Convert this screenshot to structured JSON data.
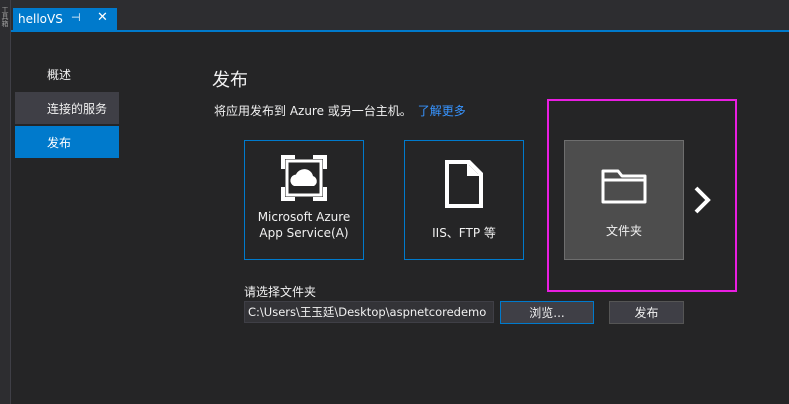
{
  "side_strip": {
    "label": "工具箱"
  },
  "tab": {
    "title": "helloVS",
    "pin_icon": "⊣",
    "close_icon": "✕"
  },
  "nav": {
    "items": [
      {
        "label": "概述",
        "state": "normal"
      },
      {
        "label": "连接的服务",
        "state": "hover"
      },
      {
        "label": "发布",
        "state": "active"
      }
    ]
  },
  "main": {
    "heading": "发布",
    "subtitle": "将应用发布到 Azure 或另一台主机。",
    "learn_more": "了解更多"
  },
  "targets": {
    "azure": {
      "label": "Microsoft Azure\nApp Service(A)"
    },
    "iis": {
      "label": "IIS、FTP 等"
    },
    "folder": {
      "label": "文件夹"
    }
  },
  "folder_picker": {
    "label": "请选择文件夹",
    "path_value": "C:\\Users\\王玉廷\\Desktop\\aspnetcoredemo",
    "browse_label": "浏览...",
    "publish_label": "发布"
  },
  "colors": {
    "accent": "#007acc",
    "highlight": "#e91ee1",
    "link": "#3794ff",
    "background": "#252526"
  }
}
